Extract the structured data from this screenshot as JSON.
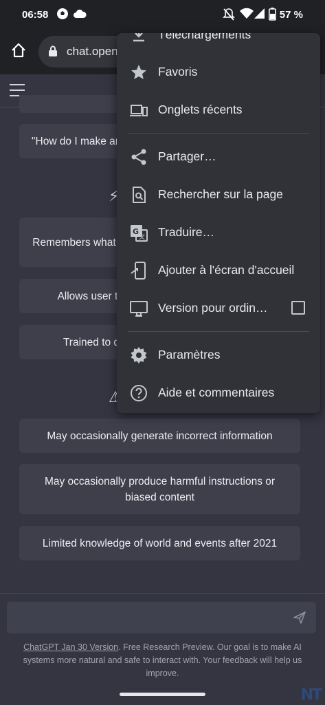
{
  "status_bar": {
    "time": "06:58",
    "battery": "57 %"
  },
  "browser": {
    "url": "chat.openai.com"
  },
  "chat": {
    "example_prompt": "\"How do I make an HTTP request in Javascript?\"",
    "capabilities": [
      "Remembers what user said earlier in the conversation",
      "Allows user to provide follow-up corrections",
      "Trained to decline inappropriate requests"
    ],
    "limitations": [
      "May occasionally generate incorrect information",
      "May occasionally produce harmful instructions or biased content",
      "Limited knowledge of world and events after 2021"
    ]
  },
  "footer": {
    "version_link": "ChatGPT Jan 30 Version",
    "text": ". Free Research Preview. Our goal is to make AI systems more natural and safe to interact with. Your feedback will help us improve."
  },
  "menu": {
    "downloads": "Téléchargements",
    "bookmarks": "Favoris",
    "recent_tabs": "Onglets récents",
    "share": "Partager…",
    "find_in_page": "Rechercher sur la page",
    "translate": "Traduire…",
    "add_to_home": "Ajouter à l'écran d'accueil",
    "desktop_site": "Version pour ordin…",
    "settings": "Paramètres",
    "help": "Aide et commentaires"
  },
  "watermark": "NT"
}
